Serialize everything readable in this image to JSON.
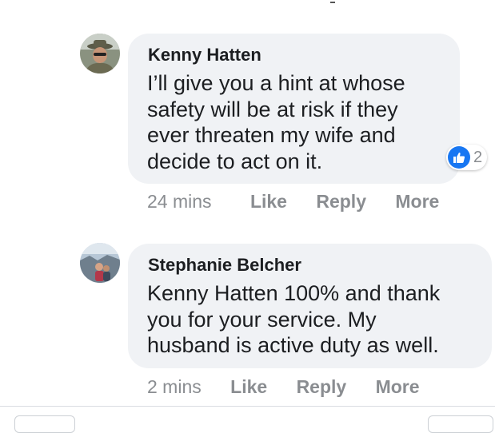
{
  "comments": [
    {
      "author": "Kenny Hatten",
      "text": "I’ll give you a hint at whose\nsafety will be at risk if they\never threaten my wife and\ndecide to act on it.",
      "time": "24 mins",
      "like_label": "Like",
      "reply_label": "Reply",
      "more_label": "More",
      "reaction_count": "2",
      "reaction_icon": "like-icon"
    },
    {
      "author": "Stephanie Belcher",
      "text": "Kenny Hatten 100% and thank\nyou for your service. My\nhusband is active duty as well.",
      "time": "2 mins",
      "like_label": "Like",
      "reply_label": "Reply",
      "more_label": "More"
    }
  ],
  "colors": {
    "bubble": "#f0f2f5",
    "meta_text": "#8a8d91",
    "like_blue": "#1877f2"
  }
}
